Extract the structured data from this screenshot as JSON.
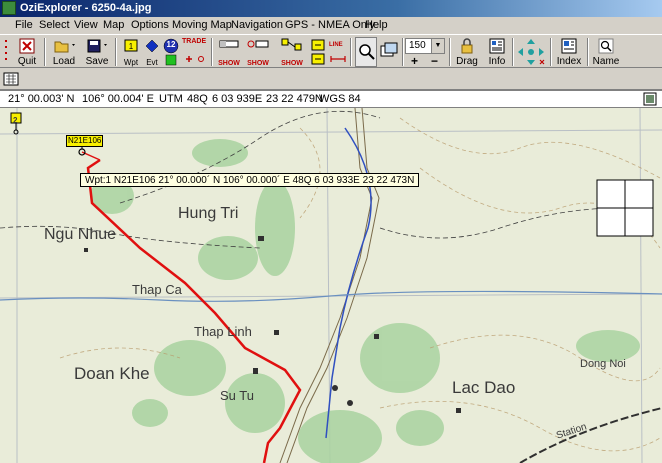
{
  "window": {
    "title": "OziExplorer - 6250-4a.jpg"
  },
  "menu": [
    "File",
    "Select",
    "View",
    "Map",
    "Options",
    "Moving Map",
    "Navigation",
    "GPS - NMEA Only",
    "Help"
  ],
  "toolbar": {
    "quit": "Quit",
    "load": "Load",
    "save": "Save",
    "wpt": "Wpt",
    "evt": "Evt",
    "trk_num": "12",
    "trade": "TRADE",
    "show1": "SHOW",
    "show2": "SHOW",
    "show3": "SHOW",
    "line": "LINE",
    "zoom_value": "150",
    "drag": "Drag",
    "info": "Info",
    "index": "Index",
    "name": "Name"
  },
  "status": {
    "lat": "21° 00.003' N",
    "lon": "106° 00.004' E",
    "utm_label": "UTM",
    "zone": "48Q",
    "easting": "6 03 939E",
    "northing": "23 22 479N",
    "datum": "WGS 84"
  },
  "map": {
    "marker_number": "2",
    "waypoint_label": "N21E106",
    "waypoint_tooltip": "Wpt:1  N21E106       21° 00.000´ N    106° 00.000´ E   48Q    6 03 933E    23 22 473N",
    "places": [
      "Hung Tri",
      "Ngu Nhue",
      "Thap Ca",
      "Thap Linh",
      "Doan Khe",
      "Su Tu",
      "Lac Dao",
      "Dong Noi",
      "Station"
    ]
  },
  "colors": {
    "track": "#e01010",
    "title_start": "#0a246a",
    "map_bg": "#e9ecd9",
    "vegetation": "#a9d3a0"
  }
}
